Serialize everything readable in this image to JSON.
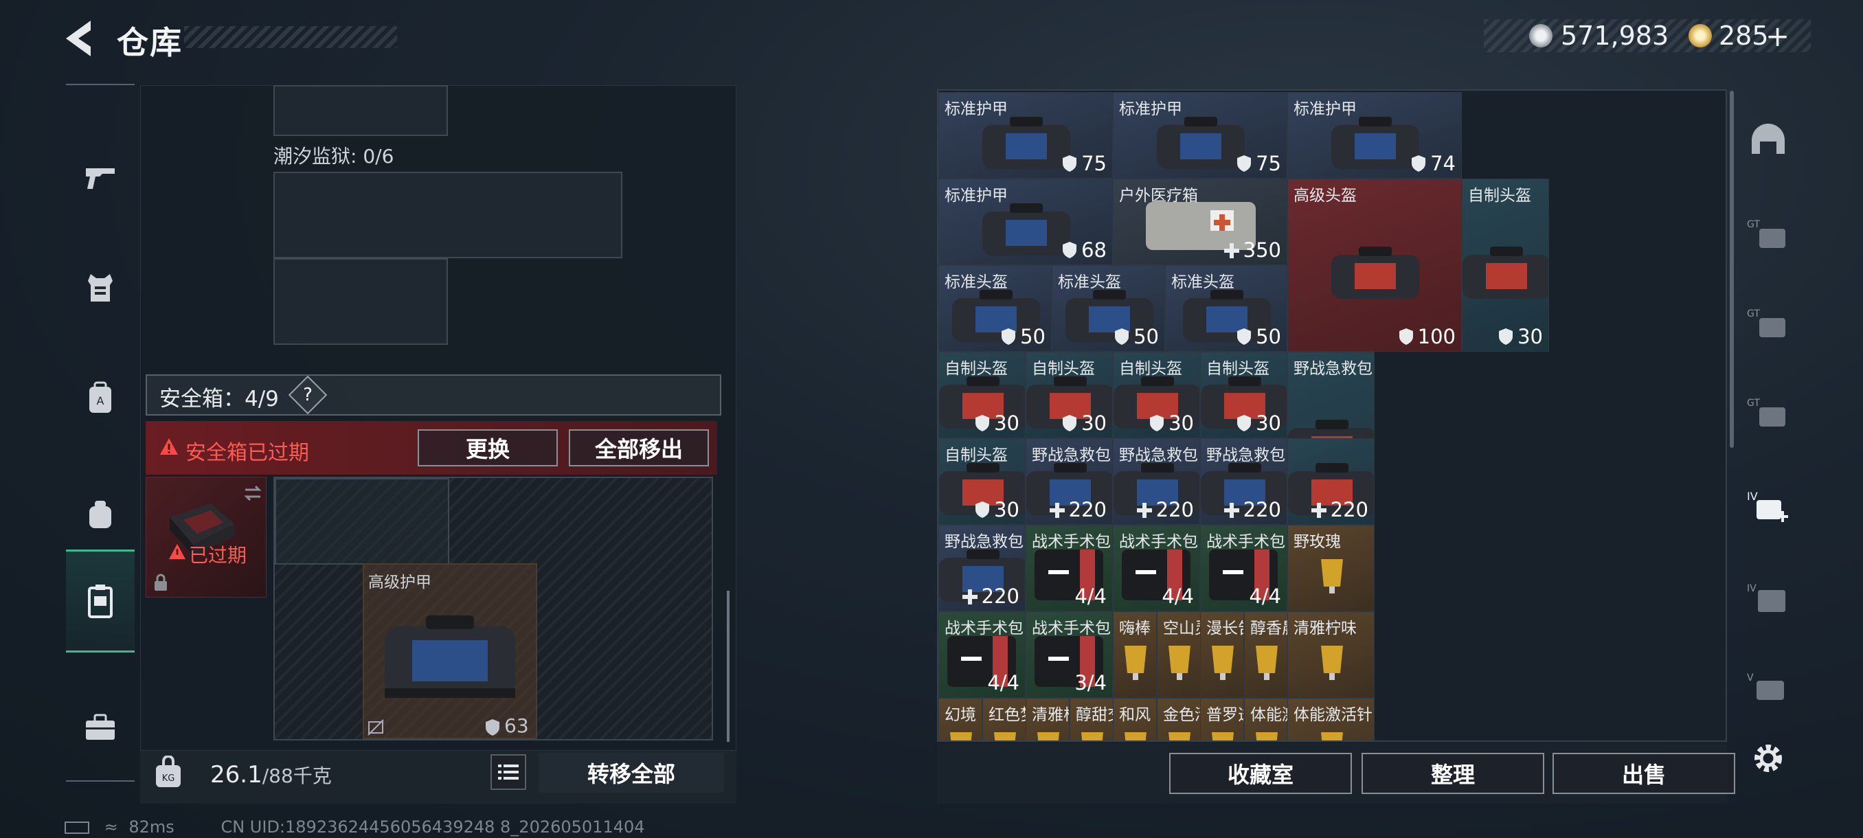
{
  "header": {
    "title": "仓库",
    "currency_silver": "571,983",
    "currency_gold": "285",
    "currency_plus": "+"
  },
  "sidebar": {
    "items": [
      "gun",
      "vest",
      "backpack",
      "ammo-bag",
      "safe-box",
      "toolbox"
    ],
    "active": "safe-box"
  },
  "left_panel": {
    "prison_label": "潮汐监狱: 0/6",
    "safebox_label": "安全箱：4/9",
    "help_label": "?",
    "expired_notice": "安全箱已过期",
    "replace_button": "更换",
    "remove_all_button": "全部移出",
    "thumb_expired": "已过期",
    "slot_item_name": "高级护甲",
    "slot_item_value": "63",
    "weight_value": "26.1",
    "weight_max": "/88千克",
    "transfer_all_button": "转移全部"
  },
  "inventory": {
    "tiles": [
      {
        "name": "标准护甲",
        "value": "75",
        "icon": "shield",
        "bg": "blue"
      },
      {
        "name": "标准护甲",
        "value": "75",
        "icon": "shield",
        "bg": "blue"
      },
      {
        "name": "标准护甲",
        "value": "74",
        "icon": "shield",
        "bg": "blue"
      },
      {
        "name": "标准护甲",
        "value": "68",
        "icon": "shield",
        "bg": "blue"
      },
      {
        "name": "户外医疗箱",
        "value": "350",
        "icon": "plus",
        "bg": "gray"
      },
      {
        "name": "高级头盔",
        "value": "100",
        "icon": "shield",
        "bg": "red"
      },
      {
        "name": "自制头盔",
        "value": "30",
        "icon": "shield",
        "bg": "teal"
      },
      {
        "name": "标准头盔",
        "value": "50",
        "icon": "shield",
        "bg": "blue"
      },
      {
        "name": "标准头盔",
        "value": "50",
        "icon": "shield",
        "bg": "blue"
      },
      {
        "name": "标准头盔",
        "value": "50",
        "icon": "shield",
        "bg": "blue"
      },
      {
        "name": "自制头盔",
        "value": "30",
        "icon": "shield",
        "bg": "teal"
      },
      {
        "name": "自制头盔",
        "value": "30",
        "icon": "shield",
        "bg": "teal"
      },
      {
        "name": "自制头盔",
        "value": "30",
        "icon": "shield",
        "bg": "teal"
      },
      {
        "name": "自制头盔",
        "value": "30",
        "icon": "shield",
        "bg": "teal"
      },
      {
        "name": "野战急救包",
        "value": "",
        "icon": "",
        "bg": "teal"
      },
      {
        "name": "自制头盔",
        "value": "30",
        "icon": "shield",
        "bg": "teal"
      },
      {
        "name": "野战急救包",
        "value": "220",
        "icon": "plus",
        "bg": "blue"
      },
      {
        "name": "野战急救包",
        "value": "220",
        "icon": "plus",
        "bg": "blue"
      },
      {
        "name": "野战急救包",
        "value": "220",
        "icon": "plus",
        "bg": "blue"
      },
      {
        "name": "",
        "value": "220",
        "icon": "plus",
        "bg": "teal"
      },
      {
        "name": "野战急救包",
        "value": "220",
        "icon": "plus",
        "bg": "blue"
      },
      {
        "name": "战术手术包",
        "value": "4/4",
        "icon": "",
        "bg": "green"
      },
      {
        "name": "战术手术包",
        "value": "4/4",
        "icon": "",
        "bg": "green"
      },
      {
        "name": "战术手术包",
        "value": "4/4",
        "icon": "",
        "bg": "green"
      },
      {
        "name": "野玫瑰",
        "value": "",
        "icon": "",
        "bg": "brown"
      },
      {
        "name": "战术手术包",
        "value": "4/4",
        "icon": "",
        "bg": "green"
      },
      {
        "name": "战术手术包",
        "value": "3/4",
        "icon": "",
        "bg": "green"
      },
      {
        "name": "嗨棒",
        "value": "",
        "icon": "",
        "bg": "brown"
      },
      {
        "name": "空山灵雨",
        "value": "",
        "icon": "",
        "bg": "brown"
      },
      {
        "name": "漫长告别",
        "value": "",
        "icon": "",
        "bg": "brown"
      },
      {
        "name": "醇香晨露",
        "value": "",
        "icon": "",
        "bg": "brown"
      },
      {
        "name": "清雅柠味",
        "value": "",
        "icon": "",
        "bg": "brown"
      },
      {
        "name": "幻境",
        "value": "",
        "icon": "",
        "bg": "brown"
      },
      {
        "name": "红色梦境",
        "value": "",
        "icon": "",
        "bg": "brown"
      },
      {
        "name": "清雅柠韵",
        "value": "",
        "icon": "",
        "bg": "brown"
      },
      {
        "name": "醇甜交响",
        "value": "",
        "icon": "",
        "bg": "brown"
      },
      {
        "name": "和风",
        "value": "",
        "icon": "",
        "bg": "brown"
      },
      {
        "name": "金色清爽",
        "value": "",
        "icon": "",
        "bg": "brown"
      },
      {
        "name": "普罗透斯...",
        "value": "",
        "icon": "",
        "bg": "brown"
      },
      {
        "name": "体能激活针",
        "value": "",
        "icon": "",
        "bg": "brown"
      },
      {
        "name": "体能激活针",
        "value": "",
        "icon": "",
        "bg": "brown"
      }
    ],
    "collection_button": "收藏室",
    "sort_button": "整理",
    "sell_button": "出售"
  },
  "status": {
    "ping": "82ms",
    "uid": "CN UID:18923624456056439248 8_202605011404"
  }
}
